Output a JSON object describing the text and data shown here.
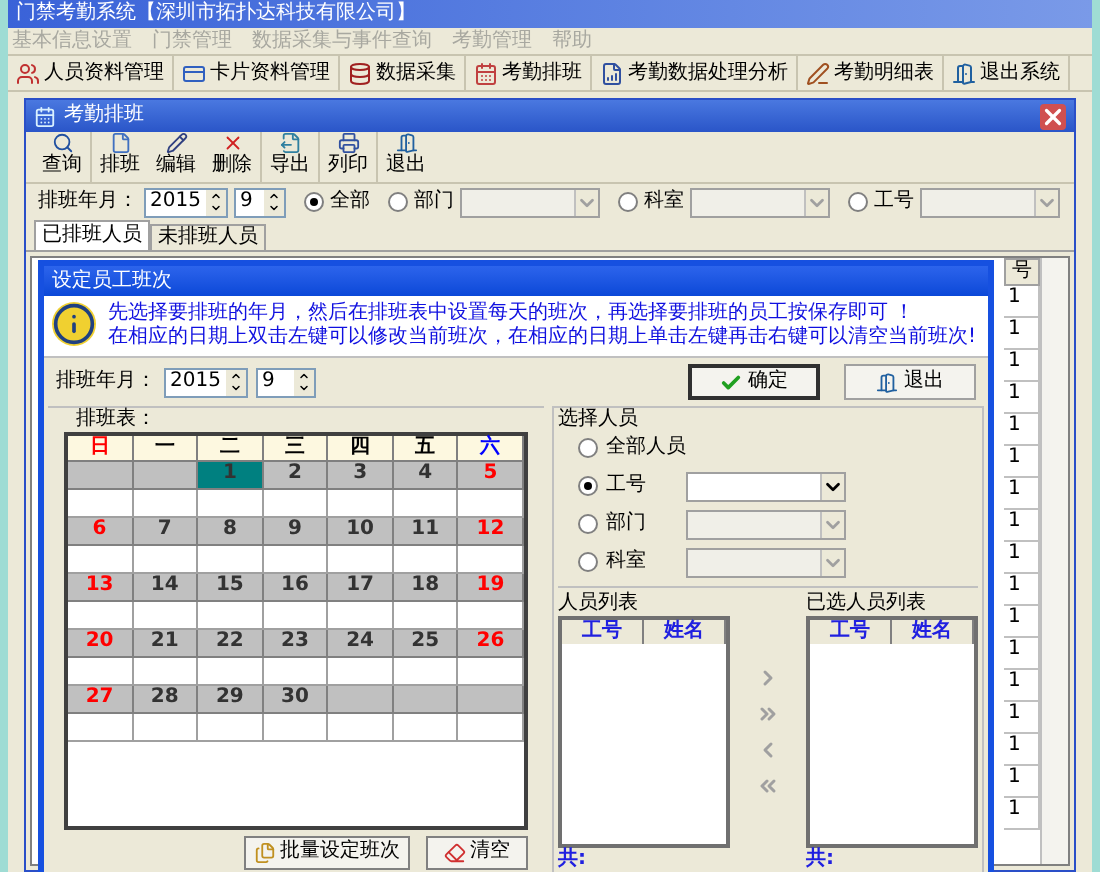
{
  "app": {
    "title": "门禁考勤系统【深圳市拓扑达科技有限公司】",
    "menu": [
      {
        "label": "基本信息设置",
        "disabled": true
      },
      {
        "label": "门禁管理",
        "disabled": true
      },
      {
        "label": "数据采集与事件查询",
        "disabled": true
      },
      {
        "label": "考勤管理",
        "disabled": true
      },
      {
        "label": "帮助",
        "disabled": true
      }
    ],
    "toolbar": [
      "人员资料管理",
      "卡片资料管理",
      "数据采集",
      "考勤排班",
      "考勤数据处理分析",
      "考勤明细表",
      "退出系统"
    ]
  },
  "window": {
    "title": "考勤排班",
    "toolbar": [
      "查询",
      "排班",
      "编辑",
      "删除",
      "导出",
      "列印",
      "退出"
    ],
    "filter": {
      "label": "排班年月：",
      "year": "2015",
      "month": "9",
      "options": [
        {
          "label": "全部",
          "selected": true,
          "kind": "radio"
        },
        {
          "label": "部门",
          "selected": false,
          "kind": "dropdown"
        },
        {
          "label": "科室",
          "selected": false,
          "kind": "dropdown"
        },
        {
          "label": "工号",
          "selected": false,
          "kind": "dropdown"
        }
      ]
    },
    "tabs": [
      {
        "label": "已排班人员",
        "selected": true
      },
      {
        "label": "未排班人员",
        "selected": false
      }
    ],
    "grid": {
      "column_header": "号",
      "cells": [
        "1",
        "1",
        "1",
        "1",
        "1",
        "1",
        "1",
        "1",
        "1",
        "1",
        "1",
        "1",
        "1",
        "1",
        "1",
        "1",
        "1"
      ]
    }
  },
  "dialog": {
    "title": "设定员工班次",
    "message": [
      "先选择要排班的年月，然后在排班表中设置每天的班次，再选择要排班的员工按保存即可 ！",
      "在相应的日期上双击左键可以修改当前班次，在相应的日期上单击左键再击右键可以清空当前班次!"
    ],
    "year_label": "排班年月：",
    "year": "2015",
    "month": "9",
    "ok": "确定",
    "exit": "退出",
    "calendar": {
      "label": "排班表：",
      "weekdays": [
        {
          "label": "日",
          "color": "#ff0000"
        },
        {
          "label": "一",
          "color": "#000000"
        },
        {
          "label": "二",
          "color": "#000000"
        },
        {
          "label": "三",
          "color": "#000000"
        },
        {
          "label": "四",
          "color": "#000000"
        },
        {
          "label": "五",
          "color": "#000000"
        },
        {
          "label": "六",
          "color": "#0000ff"
        }
      ],
      "weeks": [
        [
          {
            "kind": "blank"
          },
          {
            "kind": "blank"
          },
          {
            "kind": "day",
            "label": "1",
            "color": "#333333",
            "selected": true
          },
          {
            "kind": "day",
            "label": "2",
            "color": "#333333",
            "selected": false
          },
          {
            "kind": "day",
            "label": "3",
            "color": "#333333",
            "selected": false
          },
          {
            "kind": "day",
            "label": "4",
            "color": "#333333",
            "selected": false
          },
          {
            "kind": "day",
            "label": "5",
            "color": "#ff0000",
            "selected": false
          }
        ],
        [
          {
            "kind": "day",
            "label": "6",
            "color": "#ff0000",
            "selected": false
          },
          {
            "kind": "day",
            "label": "7",
            "color": "#333333",
            "selected": false
          },
          {
            "kind": "day",
            "label": "8",
            "color": "#333333",
            "selected": false
          },
          {
            "kind": "day",
            "label": "9",
            "color": "#333333",
            "selected": false
          },
          {
            "kind": "day",
            "label": "10",
            "color": "#333333",
            "selected": false
          },
          {
            "kind": "day",
            "label": "11",
            "color": "#333333",
            "selected": false
          },
          {
            "kind": "day",
            "label": "12",
            "color": "#ff0000",
            "selected": false
          }
        ],
        [
          {
            "kind": "day",
            "label": "13",
            "color": "#ff0000",
            "selected": false
          },
          {
            "kind": "day",
            "label": "14",
            "color": "#333333",
            "selected": false
          },
          {
            "kind": "day",
            "label": "15",
            "color": "#333333",
            "selected": false
          },
          {
            "kind": "day",
            "label": "16",
            "color": "#333333",
            "selected": false
          },
          {
            "kind": "day",
            "label": "17",
            "color": "#333333",
            "selected": false
          },
          {
            "kind": "day",
            "label": "18",
            "color": "#333333",
            "selected": false
          },
          {
            "kind": "day",
            "label": "19",
            "color": "#ff0000",
            "selected": false
          }
        ],
        [
          {
            "kind": "day",
            "label": "20",
            "color": "#ff0000",
            "selected": false
          },
          {
            "kind": "day",
            "label": "21",
            "color": "#333333",
            "selected": false
          },
          {
            "kind": "day",
            "label": "22",
            "color": "#333333",
            "selected": false
          },
          {
            "kind": "day",
            "label": "23",
            "color": "#333333",
            "selected": false
          },
          {
            "kind": "day",
            "label": "24",
            "color": "#333333",
            "selected": false
          },
          {
            "kind": "day",
            "label": "25",
            "color": "#333333",
            "selected": false
          },
          {
            "kind": "day",
            "label": "26",
            "color": "#ff0000",
            "selected": false
          }
        ],
        [
          {
            "kind": "day",
            "label": "27",
            "color": "#ff0000",
            "selected": false
          },
          {
            "kind": "day",
            "label": "28",
            "color": "#333333",
            "selected": false
          },
          {
            "kind": "day",
            "label": "29",
            "color": "#333333",
            "selected": false
          },
          {
            "kind": "day",
            "label": "30",
            "color": "#333333",
            "selected": false
          },
          {
            "kind": "blank"
          },
          {
            "kind": "blank"
          },
          {
            "kind": "blank"
          }
        ]
      ]
    },
    "select": {
      "label": "选择人员",
      "options": [
        {
          "label": "全部人员",
          "selected": false,
          "kind": "radio"
        },
        {
          "label": "工号",
          "selected": true,
          "kind": "dropdown"
        },
        {
          "label": "部门",
          "selected": false,
          "kind": "dropdown"
        },
        {
          "label": "科室",
          "selected": false,
          "kind": "dropdown"
        }
      ]
    },
    "lists": [
      {
        "label": "人员列表",
        "columns": [
          "工号",
          "姓名"
        ],
        "total": "共:"
      },
      {
        "label": "已选人员列表",
        "columns": [
          "工号",
          "姓名"
        ],
        "total": "共:"
      }
    ],
    "buttons": [
      "批量设定班次",
      "清空"
    ]
  }
}
